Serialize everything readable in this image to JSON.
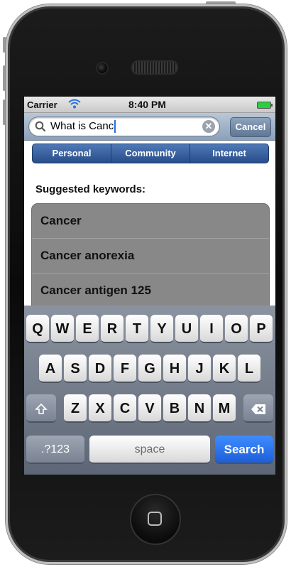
{
  "status_bar": {
    "carrier": "Carrier",
    "time": "8:40 PM"
  },
  "search": {
    "query": "What is Canc",
    "cancel_label": "Cancel"
  },
  "segments": [
    "Personal",
    "Community",
    "Internet"
  ],
  "suggested": {
    "title": "Suggested keywords:",
    "items": [
      "Cancer",
      "Cancer anorexia",
      "Cancer antigen 125"
    ]
  },
  "keyboard": {
    "row1": [
      "Q",
      "W",
      "E",
      "R",
      "T",
      "Y",
      "U",
      "I",
      "O",
      "P"
    ],
    "row2": [
      "A",
      "S",
      "D",
      "F",
      "G",
      "H",
      "J",
      "K",
      "L"
    ],
    "row3": [
      "Z",
      "X",
      "C",
      "V",
      "B",
      "N",
      "M"
    ],
    "numbers_label": ".?123",
    "space_label": "space",
    "search_label": "Search"
  },
  "colors": {
    "search_key": "#1d5fd8",
    "segment_bar": "#274d8a",
    "battery": "#2ecc40"
  }
}
